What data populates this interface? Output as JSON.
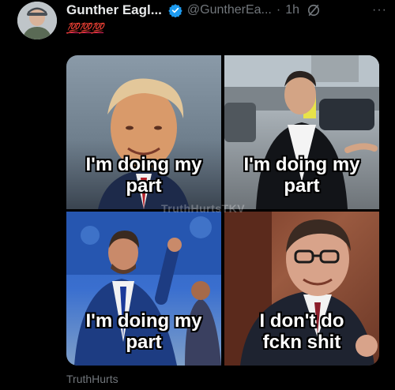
{
  "tweet": {
    "display_name": "Gunther Eagl...",
    "handle": "@GuntherEa...",
    "separator": "·",
    "time": "1h",
    "more_label": "···",
    "emoji_text": "💯💯💯",
    "accent_color": "#1d9bf0"
  },
  "meme": {
    "panels": [
      {
        "caption_line1": "I'm doing my",
        "caption_line2": "part"
      },
      {
        "caption_line1": "I'm doing my",
        "caption_line2": "part"
      },
      {
        "caption_line1": "I'm doing my",
        "caption_line2": "part"
      },
      {
        "caption_line1": "I don't do",
        "caption_line2": "fckn shit"
      }
    ],
    "watermark": "TruthHurtsTKV"
  },
  "footer": {
    "source_label": "TruthHurts"
  }
}
